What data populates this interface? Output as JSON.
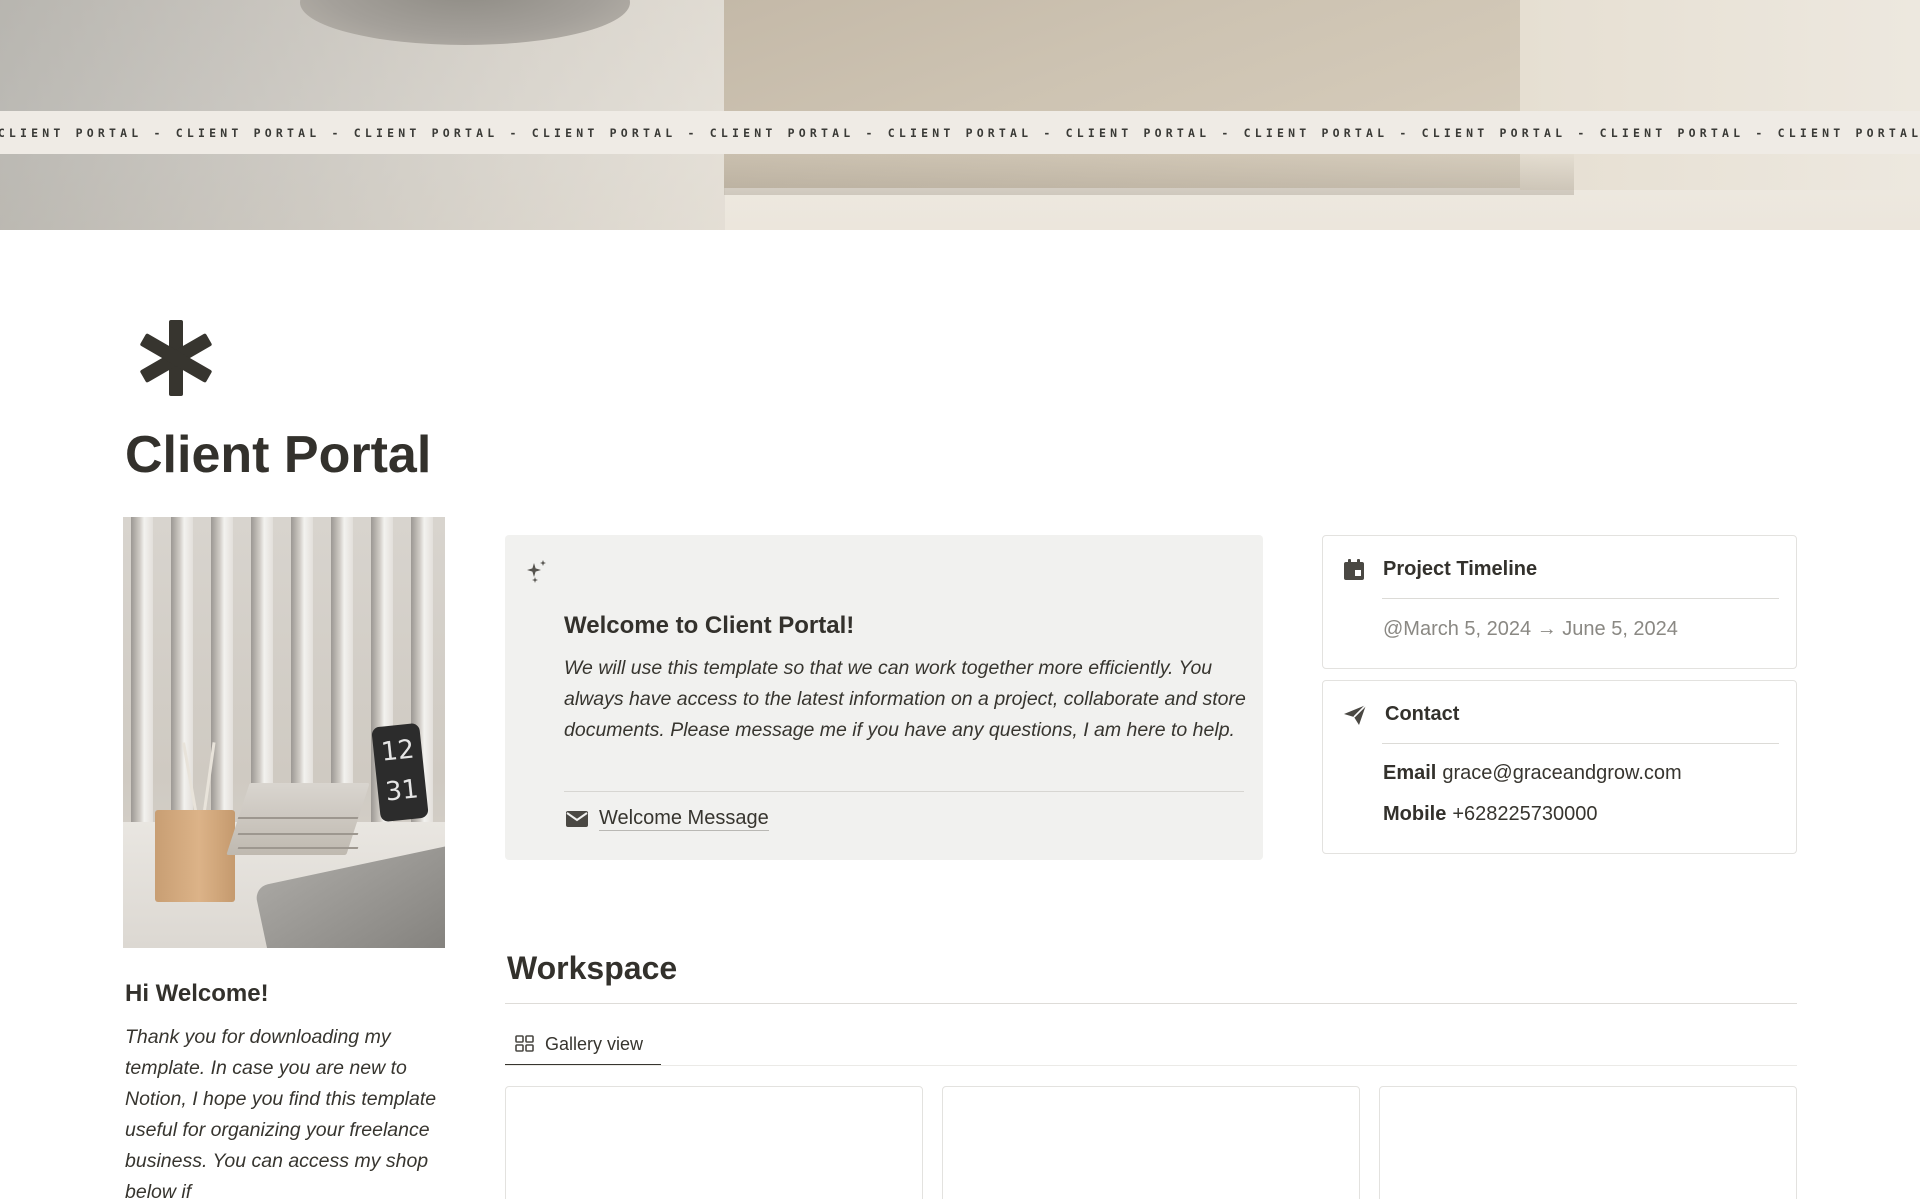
{
  "cover": {
    "banner_text": "CLIENT PORTAL - CLIENT PORTAL - CLIENT PORTAL - CLIENT PORTAL - CLIENT PORTAL - CLIENT PORTAL - CLIENT PORTAL - CLIENT PORTAL - CLIENT PORTAL - CLIENT PORTAL - CLIENT PORTAL"
  },
  "page": {
    "icon": "asterisk-icon",
    "title": "Client Portal"
  },
  "sidebar": {
    "photo": {
      "phone_time_hour": "12",
      "phone_time_minute": "31"
    },
    "greeting_title": "Hi Welcome!",
    "greeting_text": "Thank you for downloading my template. In case you are new to Notion, I hope you find this template useful for organizing your freelance business. You can access my shop below if"
  },
  "welcome": {
    "icon": "sparkles-icon",
    "title": "Welcome to Client Portal!",
    "message": "We will use this template so that we can work together more efficiently. You always have access to the latest information on a project, collaborate and store documents. Please message me if you have any questions, I am here to help.",
    "link_icon": "envelope-icon",
    "link_label": "Welcome Message"
  },
  "timeline": {
    "icon": "calendar-icon",
    "label": "Project Timeline",
    "dates": "@March 5, 2024 → June 5, 2024"
  },
  "contact": {
    "icon": "paper-plane-icon",
    "label": "Contact",
    "email_label": "Email",
    "email_value": "grace@graceandgrow.com",
    "mobile_label": "Mobile",
    "mobile_value": "+628225730000"
  },
  "workspace": {
    "title": "Workspace",
    "view_icon": "gallery-grid-icon",
    "view_label": "Gallery view",
    "cards": [
      "",
      "",
      ""
    ]
  },
  "colors": {
    "text": "#37352f",
    "callout_bg": "#f1f1ef",
    "border": "#e3e2df",
    "muted": "#8a8883"
  }
}
